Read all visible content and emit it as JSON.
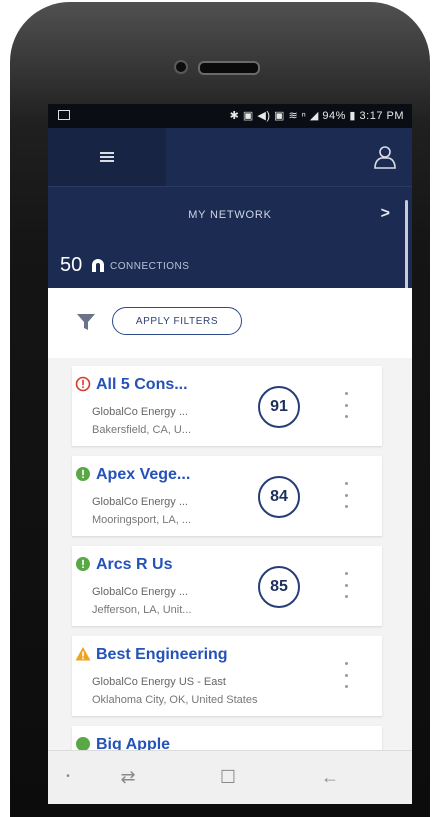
{
  "status_bar": {
    "right_text": "✱ ▣ ◀) ▣ ≋ ⁿ ◢ 94% ▮ 3:17 PM",
    "time": "3:17 PM",
    "battery": "94%"
  },
  "header": {
    "menu_icon": "hamburger-icon",
    "user_icon": "user-icon"
  },
  "network": {
    "title": "MY NETWORK",
    "chevron": ">"
  },
  "connections": {
    "count": "50",
    "label": "CONNECTIONS",
    "icon": "connections-icon"
  },
  "filters": {
    "button_label": "APPLY FILTERS",
    "icon": "filter-icon"
  },
  "list": [
    {
      "name": "All 5 Cons...",
      "company": "GlobalCo Energy ...",
      "location": "Bakersfield, CA, U...",
      "score": "91",
      "status": "error"
    },
    {
      "name": "Apex Vege...",
      "company": "GlobalCo Energy ...",
      "location": "Mooringsport, LA, ...",
      "score": "84",
      "status": "ok"
    },
    {
      "name": "Arcs R Us",
      "company": "GlobalCo Energy ...",
      "location": "Jefferson, LA, Unit...",
      "score": "85",
      "status": "ok"
    },
    {
      "name": "Best Engineering",
      "company": "GlobalCo Energy US - East",
      "location": "Oklahoma City, OK, United States",
      "score": "",
      "status": "warning"
    },
    {
      "name": "Big Apple",
      "company": "",
      "location": "",
      "score": "",
      "status": "ok"
    }
  ],
  "colors": {
    "header_bg": "#1c2b52",
    "link_blue": "#2552b8",
    "status_ok": "#5aa845",
    "status_error": "#d9382f",
    "status_warning": "#f0a321"
  }
}
